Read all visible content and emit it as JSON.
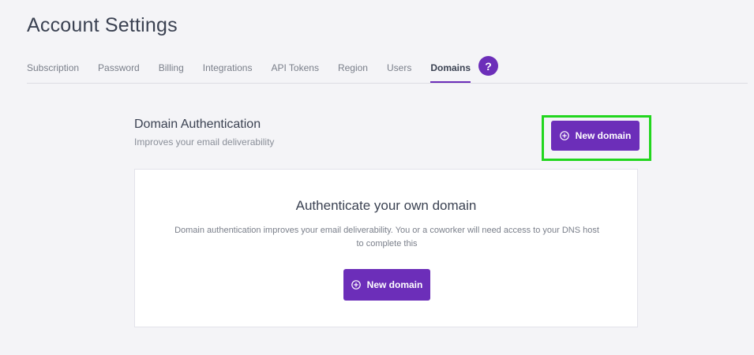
{
  "header": {
    "title": "Account Settings"
  },
  "tabs": [
    {
      "label": "Subscription",
      "active": false
    },
    {
      "label": "Password",
      "active": false
    },
    {
      "label": "Billing",
      "active": false
    },
    {
      "label": "Integrations",
      "active": false
    },
    {
      "label": "API Tokens",
      "active": false
    },
    {
      "label": "Region",
      "active": false
    },
    {
      "label": "Users",
      "active": false
    },
    {
      "label": "Domains",
      "active": true
    }
  ],
  "help": {
    "label": "?"
  },
  "section": {
    "title": "Domain Authentication",
    "subtitle": "Improves your email deliverability",
    "new_domain_label": "New domain"
  },
  "card": {
    "title": "Authenticate your own domain",
    "description": "Domain authentication improves your email deliverability. You or a coworker will need access to your DNS host to complete this",
    "new_domain_label": "New domain"
  },
  "icons": {
    "add": "plus-circle-icon"
  },
  "colors": {
    "accent": "#6c2eb9",
    "highlight": "#22d61e",
    "background": "#f4f4f7"
  }
}
